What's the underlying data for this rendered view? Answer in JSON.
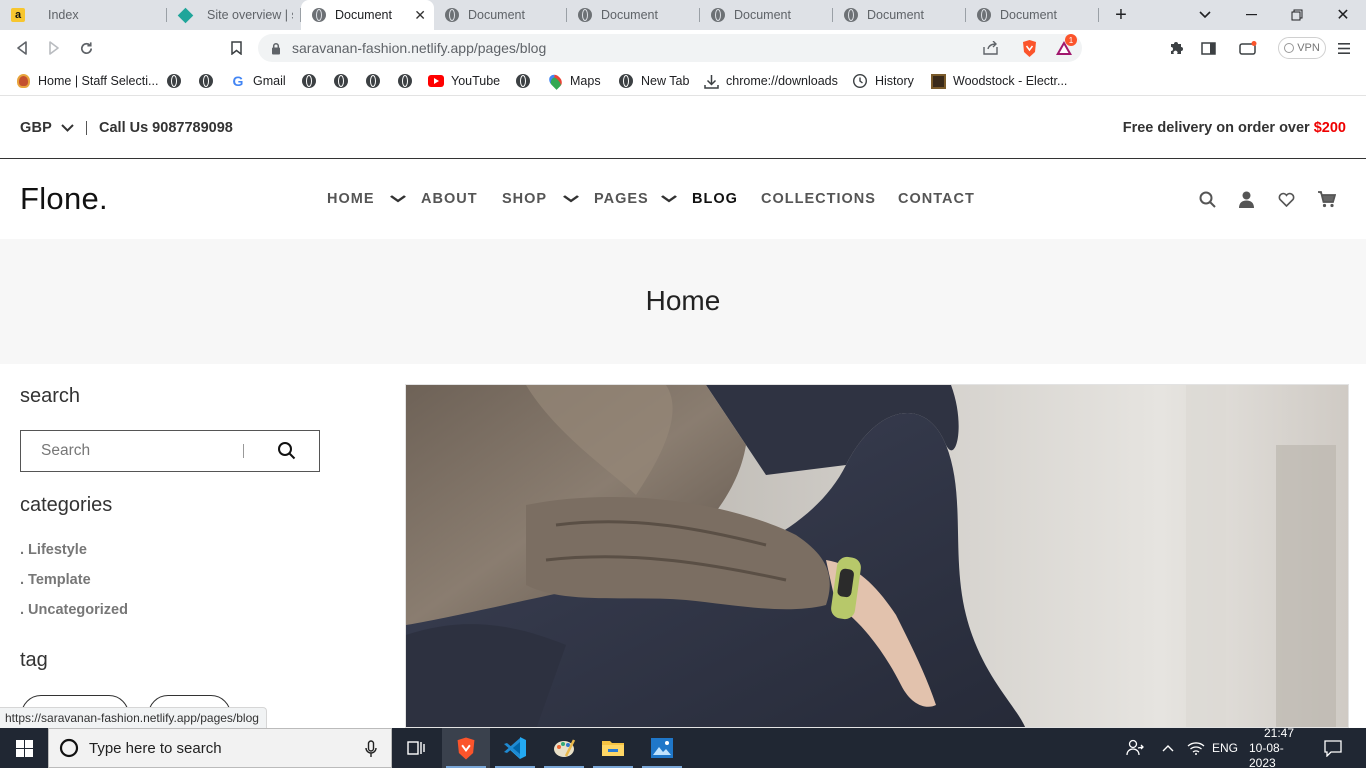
{
  "browser": {
    "tabs": [
      {
        "title": "Index",
        "favicon": "amazon-icon",
        "active": false
      },
      {
        "title": "Site overview | saravanan-fashion",
        "favicon": "netlify-icon",
        "active": false
      },
      {
        "title": "Document",
        "favicon": "globe-icon",
        "active": true
      },
      {
        "title": "Document",
        "favicon": "globe-icon",
        "active": false
      },
      {
        "title": "Document",
        "favicon": "globe-icon",
        "active": false
      },
      {
        "title": "Document",
        "favicon": "globe-icon",
        "active": false
      },
      {
        "title": "Document",
        "favicon": "globe-icon",
        "active": false
      },
      {
        "title": "Document",
        "favicon": "globe-icon",
        "active": false
      }
    ],
    "url": "saravanan-fashion.netlify.app/pages/blog",
    "vpn_label": "VPN",
    "brave_rewards_badge": "1",
    "bookmarks": [
      {
        "label": "Home | Staff Selecti...",
        "icon": "emblem-icon"
      },
      {
        "label": "",
        "icon": "globe-icon"
      },
      {
        "label": "",
        "icon": "globe-icon"
      },
      {
        "label": "Gmail",
        "icon": "google-icon"
      },
      {
        "label": "",
        "icon": "globe-icon"
      },
      {
        "label": "",
        "icon": "globe-icon"
      },
      {
        "label": "",
        "icon": "globe-icon"
      },
      {
        "label": "",
        "icon": "globe-icon"
      },
      {
        "label": "YouTube",
        "icon": "youtube-icon"
      },
      {
        "label": "",
        "icon": "globe-icon"
      },
      {
        "label": "Maps",
        "icon": "maps-icon"
      },
      {
        "label": "New Tab",
        "icon": "globe-icon"
      },
      {
        "label": "chrome://downloads",
        "icon": "download-icon"
      },
      {
        "label": "History",
        "icon": "history-icon"
      },
      {
        "label": "Woodstock - Electr...",
        "icon": "woodstock-icon"
      }
    ],
    "status_url": "https://saravanan-fashion.netlify.app/pages/blog"
  },
  "site": {
    "currency": "GBP",
    "call_us": "Call Us 9087789098",
    "delivery_text": "Free delivery on order over",
    "delivery_amount": "$200",
    "logo": "Flone.",
    "nav": [
      "HOME",
      "ABOUT",
      "SHOP",
      "PAGES",
      "BLOG",
      "COLLECTIONS",
      "CONTACT"
    ],
    "active_nav": "BLOG",
    "page_title": "Home",
    "sidebar": {
      "search_heading": "search",
      "search_placeholder": "Search",
      "categories_heading": "categories",
      "categories": [
        ". Lifestyle",
        ". Template",
        ". Uncategorized"
      ],
      "tag_heading": "tag"
    },
    "colors": {
      "accent_red": "#e00000",
      "text_dark": "#333333",
      "breadcrumb_bg": "#f7f7f7"
    }
  },
  "taskbar": {
    "search_placeholder": "Type here to search",
    "language": "ENG",
    "time": "21:47",
    "date": "10-08-2023"
  }
}
